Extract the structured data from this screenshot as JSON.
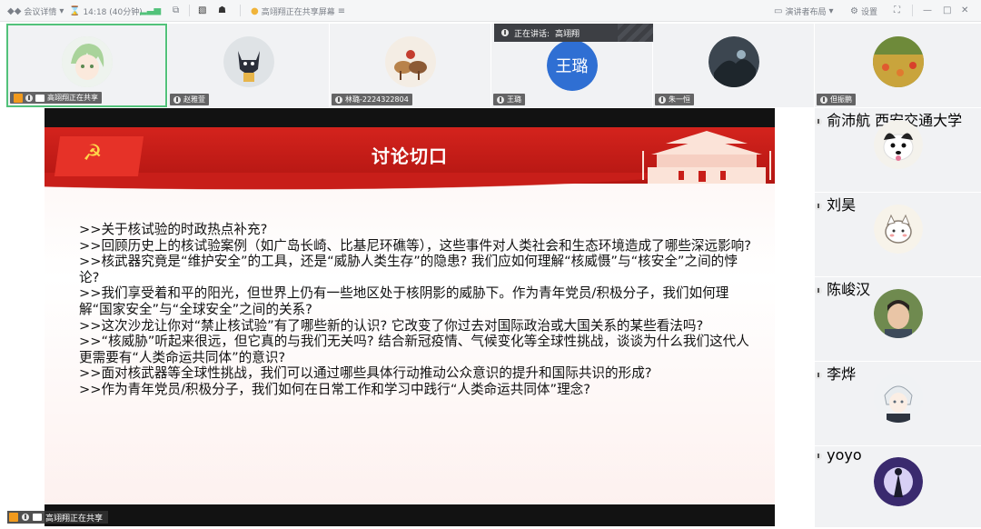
{
  "topbar": {
    "meeting_details": "会议详情",
    "timer": "14:18 (40分钟)",
    "sharing_status": "高翊翔正在共享屏幕",
    "speaker_layout": "演讲者布局",
    "settings": "设置"
  },
  "speaking_banner": {
    "prefix": "正在讲话:",
    "name": "高翊翔"
  },
  "participants_top": [
    {
      "name": "高翊翔正在共享"
    },
    {
      "name": "赵雅萱"
    },
    {
      "name": "林璐-2224322804"
    },
    {
      "name": "王璐",
      "initials": "王璐"
    },
    {
      "name": "朱一恒"
    },
    {
      "name": "但振鹏"
    }
  ],
  "participants_right": [
    {
      "name": "俞沛航 西安交通大学"
    },
    {
      "name": "刘昊"
    },
    {
      "name": "陈峻汉"
    },
    {
      "name": "李烨"
    },
    {
      "name": "yoyo"
    }
  ],
  "slide": {
    "title": "讨论切口",
    "lines": [
      ">>关于核试验的时政热点补充?",
      ">>回顾历史上的核试验案例（如广岛长崎、比基尼环礁等），这些事件对人类社会和生态环境造成了哪些深远影响?",
      ">>核武器究竟是“维护安全”的工具，还是“威胁人类生存”的隐患? 我们应如何理解“核威慑”与“核安全”之间的悖论?",
      ">>我们享受着和平的阳光，但世界上仍有一些地区处于核阴影的威胁下。作为青年党员/积极分子，我们如何理解“国家安全”与“全球安全”之间的关系?",
      ">>这次沙龙让你对“禁止核试验”有了哪些新的认识? 它改变了你过去对国际政治或大国关系的某些看法吗?",
      ">>“核威胁”听起来很远，但它真的与我们无关吗? 结合新冠疫情、气候变化等全球性挑战，谈谈为什么我们这代人更需要有“人类命运共同体”的意识?",
      ">>面对核武器等全球性挑战，我们可以通过哪些具体行动推动公众意识的提升和国际共识的形成?",
      ">>作为青年党员/积极分子，我们如何在日常工作和学习中践行“人类命运共同体”理念?"
    ]
  },
  "bottom_status": {
    "text": "高翊翔正在共享"
  },
  "colors": {
    "accent_green": "#52c27a",
    "slide_red": "#c81e19",
    "avatar_blue": "#2f6fd3"
  }
}
